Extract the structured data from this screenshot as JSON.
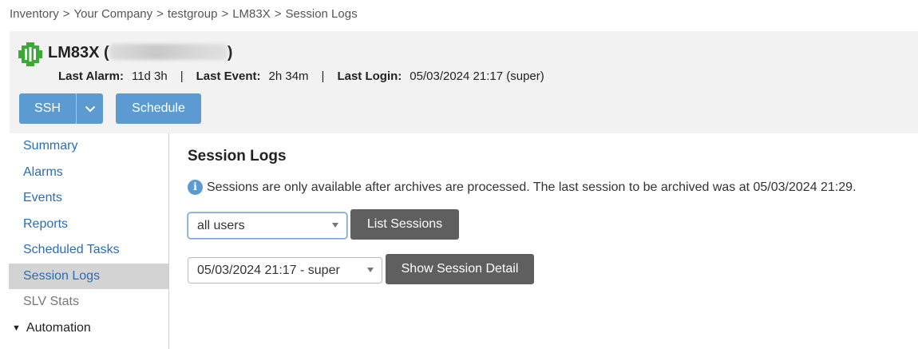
{
  "breadcrumb": [
    "Inventory",
    "Your Company",
    "testgroup",
    "LM83X",
    "Session Logs"
  ],
  "breadcrumb_separator": ">",
  "device": {
    "name": "LM83X",
    "open_paren": "(",
    "close_paren": ")",
    "logo_color": "#3aa935"
  },
  "stats": {
    "last_alarm_label": "Last Alarm:",
    "last_alarm_value": "11d 3h",
    "last_event_label": "Last Event:",
    "last_event_value": "2h 34m",
    "last_login_label": "Last Login:",
    "last_login_value": "05/03/2024 21:17 (super)",
    "separator": "|"
  },
  "toolbar": {
    "ssh_label": "SSH",
    "schedule_label": "Schedule"
  },
  "sidebar": {
    "items": [
      {
        "label": "Summary"
      },
      {
        "label": "Alarms"
      },
      {
        "label": "Events"
      },
      {
        "label": "Reports"
      },
      {
        "label": "Scheduled Tasks"
      },
      {
        "label": "Session Logs"
      },
      {
        "label": "SLV Stats"
      }
    ],
    "group_label": "Automation"
  },
  "main": {
    "title": "Session Logs",
    "info_text": "Sessions are only available after archives are processed. The last session to be archived was at 05/03/2024 21:29.",
    "user_select_value": "all users",
    "list_button": "List Sessions",
    "session_select_value": "05/03/2024 21:17 - super",
    "detail_button": "Show Session Detail"
  },
  "colors": {
    "accent_button": "#5b9bd1",
    "dark_button": "#5f5f5f",
    "link": "#2a6db5",
    "active_nav_bg": "#d3d3d3",
    "header_bg": "#f2f2f2"
  }
}
